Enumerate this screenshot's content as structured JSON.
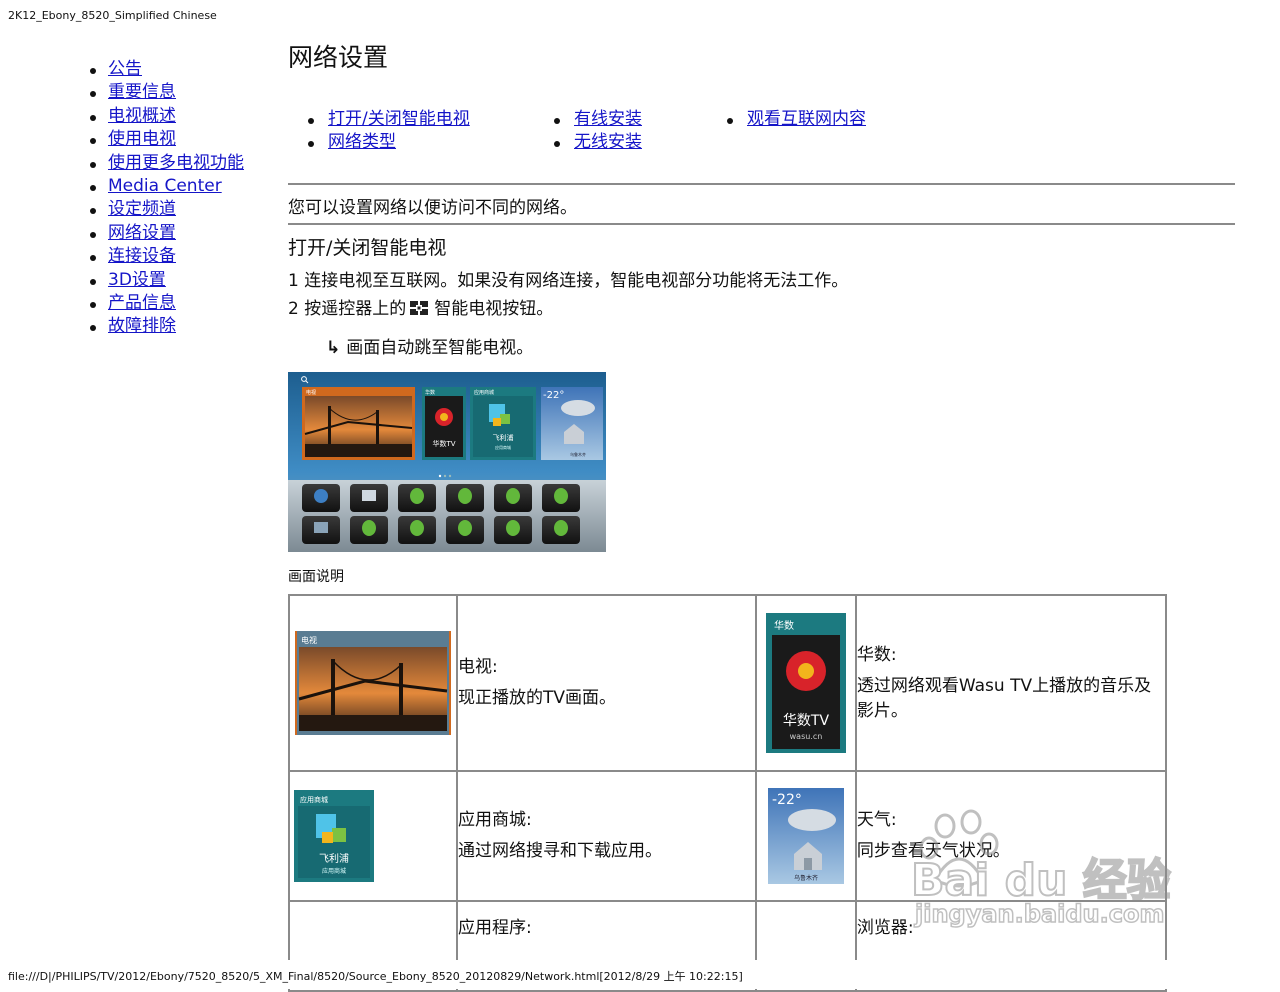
{
  "header": {
    "text": "2K12_Ebony_8520_Simplified Chinese"
  },
  "footer": {
    "text": "file:///D|/PHILIPS/TV/2012/Ebony/7520_8520/5_XM_Final/8520/Source_Ebony_8520_20120829/Network.html[2012/8/29 上午 10:22:15]"
  },
  "nav": {
    "items": [
      "公告",
      "重要信息",
      "电视概述",
      "使用电视",
      "使用更多电视功能",
      "Media Center",
      "设定频道",
      "网络设置",
      "连接设备",
      "3D设置",
      "产品信息",
      "故障排除"
    ]
  },
  "page": {
    "title": "网络设置"
  },
  "toc": {
    "col1": [
      "打开/关闭智能电视",
      "网络类型"
    ],
    "col2": [
      "有线安装",
      "无线安装"
    ],
    "col3": [
      "观看互联网内容"
    ]
  },
  "intro": "您可以设置网络以便访问不同的网络。",
  "section": {
    "title": "打开/关闭智能电视",
    "step1": "1 连接电视至互联网。如果没有网络连接，智能电视部分功能将无法工作。",
    "step2_pre": "2 按遥控器上的",
    "step2_post": "智能电视按钮。",
    "result": "画面自动跳至智能电视。"
  },
  "screenshot": {
    "tile_tv": "电视",
    "tile_wasu": "华数",
    "tile_store": "应用商城",
    "temp": "-22°",
    "weather_city": "乌鲁木齐",
    "wasu_logo": "华数TV",
    "wasu_url": "wasu.cn",
    "store_logo": "飞利浦",
    "store_sub": "应用商城"
  },
  "caption": "画面说明",
  "table": {
    "rows": [
      [
        {
          "name": "电视:",
          "desc": "现正播放的TV画面。"
        },
        {
          "name": "华数:",
          "desc": "透过网络观看Wasu TV上播放的音乐及影片。"
        }
      ],
      [
        {
          "name": "应用商城:",
          "desc": "通过网络搜寻和下载应用。"
        },
        {
          "name": "天气:",
          "desc": "同步查看天气状况。"
        }
      ],
      [
        {
          "name": "应用程序:",
          "desc": ""
        },
        {
          "name": "浏览器:",
          "desc": ""
        }
      ]
    ]
  },
  "watermark": {
    "brand": "Bai du 经验",
    "url": "jingyan.baidu.com"
  },
  "colors": {
    "link": "#1515c8",
    "rule": "#8a8a8a",
    "tile_orange": "#d0691e",
    "tile_teal": "#1c7a80"
  }
}
